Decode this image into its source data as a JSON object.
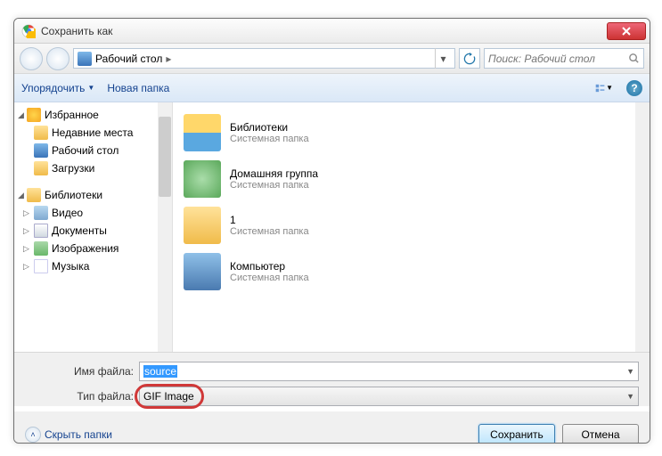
{
  "window": {
    "title": "Сохранить как"
  },
  "nav": {
    "location": "Рабочий стол",
    "search_placeholder": "Поиск: Рабочий стол"
  },
  "toolbar": {
    "organize": "Упорядочить",
    "new_folder": "Новая папка"
  },
  "tree": {
    "favorites": {
      "label": "Избранное",
      "items": [
        {
          "label": "Недавние места"
        },
        {
          "label": "Рабочий стол"
        },
        {
          "label": "Загрузки"
        }
      ]
    },
    "libraries": {
      "label": "Библиотеки",
      "items": [
        {
          "label": "Видео"
        },
        {
          "label": "Документы"
        },
        {
          "label": "Изображения"
        },
        {
          "label": "Музыка"
        }
      ]
    }
  },
  "content": {
    "items": [
      {
        "title": "Библиотеки",
        "sub": "Системная папка"
      },
      {
        "title": "Домашняя группа",
        "sub": "Системная папка"
      },
      {
        "title": "1",
        "sub": "Системная папка"
      },
      {
        "title": "Компьютер",
        "sub": "Системная папка"
      }
    ]
  },
  "fields": {
    "filename_label": "Имя файла:",
    "filename_value": "source",
    "filetype_label": "Тип файла:",
    "filetype_value": "GIF Image"
  },
  "actions": {
    "hide_folders": "Скрыть папки",
    "save": "Сохранить",
    "cancel": "Отмена"
  }
}
